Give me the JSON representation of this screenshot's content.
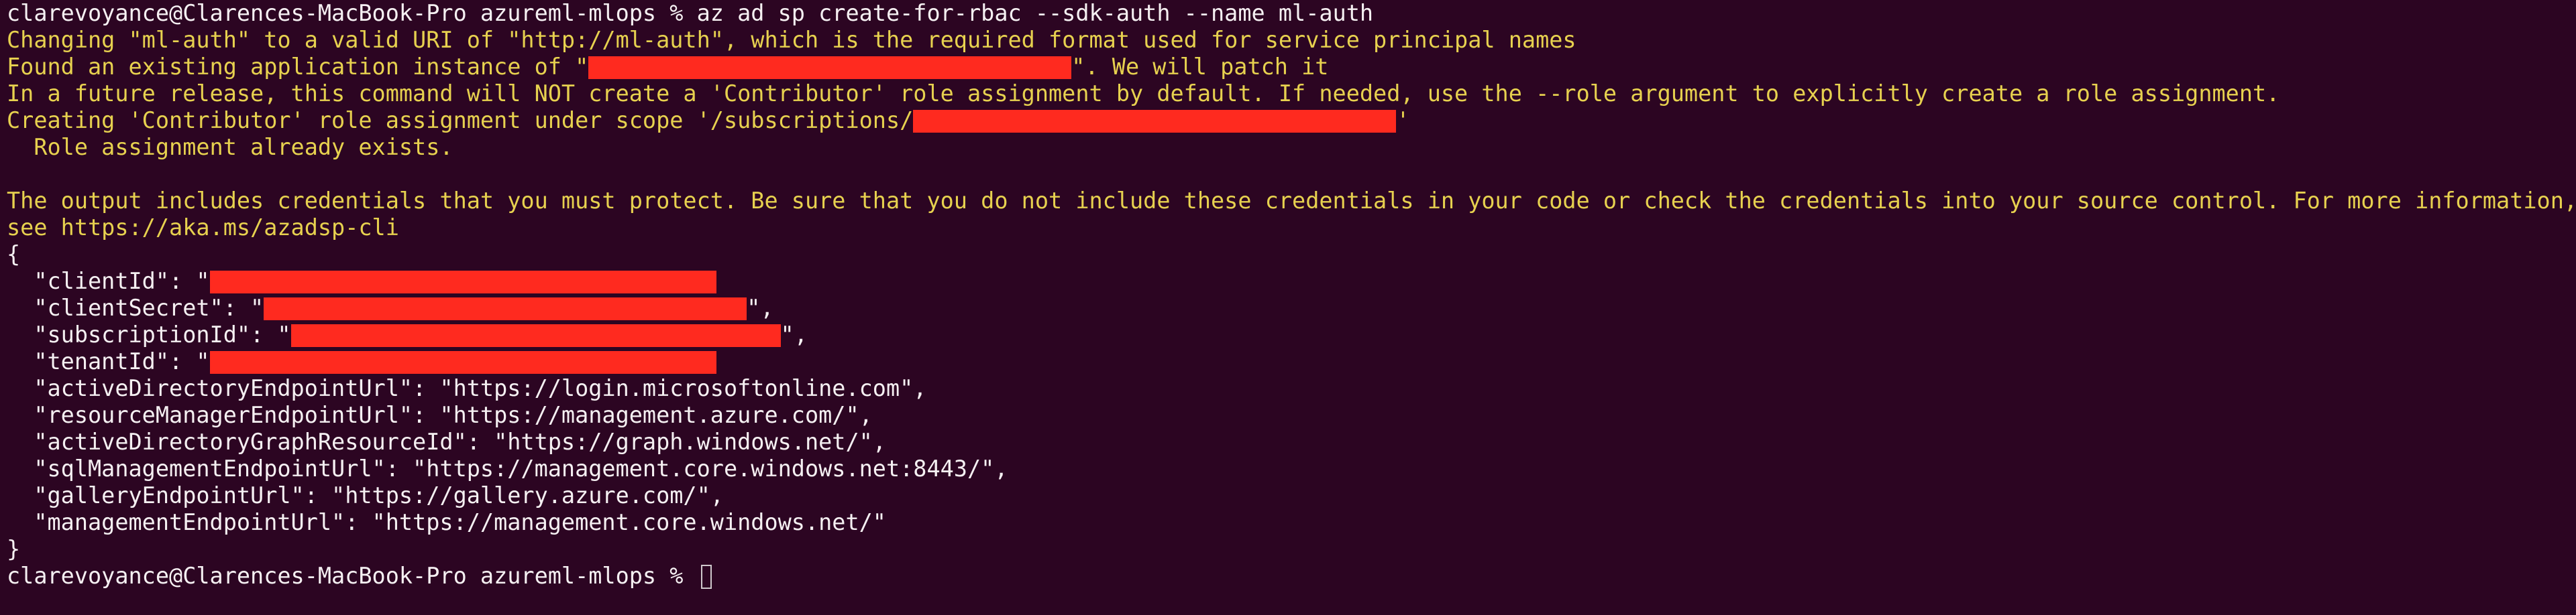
{
  "terminal": {
    "command_line": "clarevoyance@Clarences-MacBook-Pro azureml-mlops % az ad sp create-for-rbac --sdk-auth --name ml-auth",
    "warning_lines": {
      "line1": "Changing \"ml-auth\" to a valid URI of \"http://ml-auth\", which is the required format used for service principal names",
      "line2_prefix": "Found an existing application instance of \"",
      "line2_suffix": "\". We will patch it",
      "line3": "In a future release, this command will NOT create a 'Contributor' role assignment by default. If needed, use the --role argument to explicitly create a role assignment.",
      "line4_prefix": "Creating 'Contributor' role assignment under scope '/subscriptions/",
      "line4_suffix": "'",
      "line5": "  Role assignment already exists."
    },
    "info_lines": {
      "line1": "The output includes credentials that you must protect. Be sure that you do not include these credentials in your code or check the credentials into your source control. For more information,",
      "line2": "see https://aka.ms/azadsp-cli"
    },
    "json_output": {
      "open_brace": "{",
      "client_id_prefix": "  \"clientId\": \"",
      "client_secret_prefix": "  \"clientSecret\": \"",
      "client_secret_suffix": "\",",
      "subscription_id_prefix": "  \"subscriptionId\": \"",
      "subscription_id_suffix": "\",",
      "tenant_id_prefix": "  \"tenantId\": \"",
      "entries": [
        "  \"activeDirectoryEndpointUrl\": \"https://login.microsoftonline.com\",",
        "  \"resourceManagerEndpointUrl\": \"https://management.azure.com/\",",
        "  \"activeDirectoryGraphResourceId\": \"https://graph.windows.net/\",",
        "  \"sqlManagementEndpointUrl\": \"https://management.core.windows.net:8443/\",",
        "  \"galleryEndpointUrl\": \"https://gallery.azure.com/\",",
        "  \"managementEndpointUrl\": \"https://management.core.windows.net/\""
      ],
      "close_brace": "}"
    },
    "prompt": "clarevoyance@Clarences-MacBook-Pro azureml-mlops % "
  },
  "colors": {
    "background": "#2c0522",
    "text": "#f5f0f2",
    "warning": "#e7d14f",
    "redaction": "#ff2a1f"
  }
}
